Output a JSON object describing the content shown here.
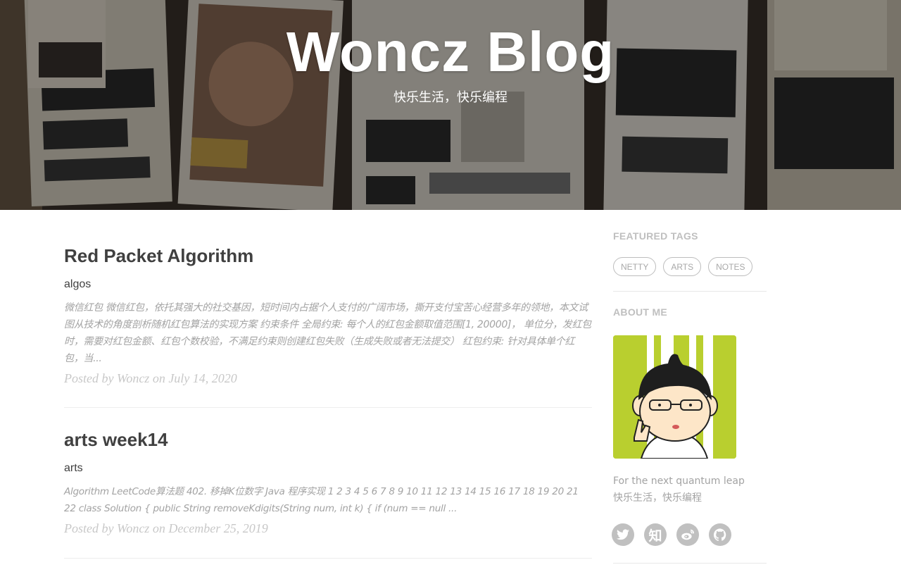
{
  "header": {
    "title": "Woncz Blog",
    "subtitle": "快乐生活，快乐编程"
  },
  "posts": [
    {
      "title": "Red Packet Algorithm",
      "subtitle": "algos",
      "excerpt": "微信红包 微信红包，依托其强大的社交基因，短时间内占据个人支付的广阔市场，撕开支付宝苦心经营多年的领地，本文试图从技术的角度剖析随机红包算法的实现方案 约束条件 全局约束: 每个人的红包金额取值范围[1, 20000]， 单位分，发红包时，需要对红包金额、红包个数校验，不满足约束则创建红包失败（生成失败或者无法提交） 红包约束: 针对具体单个红包，当...",
      "meta": "Posted by Woncz on July 14, 2020"
    },
    {
      "title": "arts week14",
      "subtitle": "arts",
      "excerpt": "Algorithm LeetCode算法题 402. 移掉K位数字 Java 程序实现 1 2 3 4 5 6 7 8 9 10 11 12 13 14 15 16 17 18 19 20 21 22 class Solution { public String removeKdigits(String num, int k) { if (num == null ...",
      "meta": "Posted by Woncz on December 25, 2019"
    }
  ],
  "sidebar": {
    "featured_tags_heading": "FEATURED TAGS",
    "tags": [
      "NETTY",
      "ARTS",
      "NOTES"
    ],
    "about_heading": "ABOUT ME",
    "about_line1": "For the next quantum leap",
    "about_line2": "快乐生活，快乐编程",
    "socials": [
      {
        "icon": "twitter-icon",
        "glyph": "🐦"
      },
      {
        "icon": "zhihu-icon",
        "glyph": "知"
      },
      {
        "icon": "weibo-icon",
        "glyph": "微"
      },
      {
        "icon": "github-icon",
        "glyph": "⌥"
      }
    ]
  },
  "colors": {
    "title_text": "#404040",
    "excerpt_text": "#a3a3a3",
    "meta_text": "#c8c8c8",
    "tag_border": "#bdbdbd",
    "social_bg": "#c0c0c0",
    "avatar_bg": "#b9cf2f"
  }
}
